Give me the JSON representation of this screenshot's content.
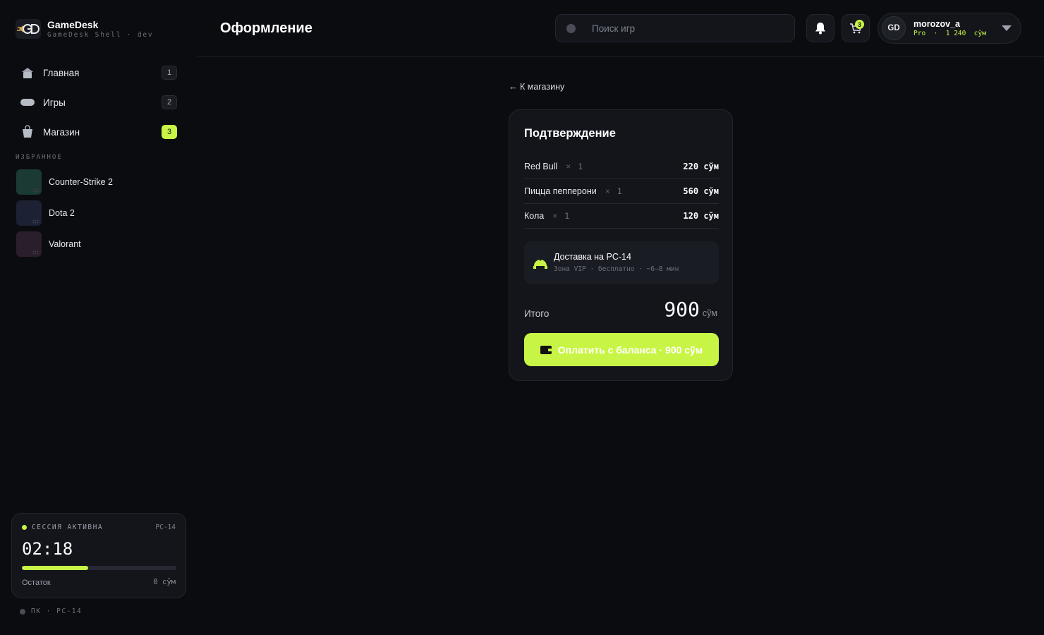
{
  "brand": {
    "name": "GameDesk",
    "subtitle": "GameDesk Shell · dev"
  },
  "nav": {
    "items": [
      {
        "label": "Главная",
        "badge": "1",
        "icon": "home-icon"
      },
      {
        "label": "Игры",
        "badge": "2",
        "icon": "gamepad-icon"
      },
      {
        "label": "Магазин",
        "badge": "3",
        "icon": "shopping-bag-icon",
        "active_badge": true
      }
    ]
  },
  "favorites": {
    "heading": "ИЗБРАННОЕ",
    "items": [
      {
        "label": "Counter-Strike 2",
        "color": "#1b3a34"
      },
      {
        "label": "Dota 2",
        "color": "#1c2233"
      },
      {
        "label": "Valorant",
        "color": "#2a1d2c"
      }
    ]
  },
  "session": {
    "status": "СЕССИЯ АКТИВНА",
    "pc": "PC-14",
    "time": "02:18",
    "progress": 0.43,
    "remaining_label": "Остаток",
    "remaining_amount": "0 сўм"
  },
  "footer": {
    "pc_label": "ПК · PC-14"
  },
  "header": {
    "title": "Оформление",
    "search_placeholder": "Поиск игр",
    "cart_count": "3",
    "user": {
      "initials": "GD",
      "name": "morozov_a",
      "meta": "Pro  ·  1 240  сўм"
    }
  },
  "checkout": {
    "back_label": "← К магазину",
    "title": "Подтверждение",
    "items": [
      {
        "name": "Red Bull",
        "x": "×",
        "qty": "1",
        "price": "220 сўм"
      },
      {
        "name": "Пицца пепперони",
        "x": "×",
        "qty": "1",
        "price": "560 сўм"
      },
      {
        "name": "Кола",
        "x": "×",
        "qty": "1",
        "price": "120 сўм"
      }
    ],
    "delivery": {
      "title": "Доставка на PC-14",
      "subtitle": "Зона VIP · бесплатно · ~6–8 мин"
    },
    "total_label": "Итого",
    "total_value": "900",
    "total_currency": "сўм",
    "pay_label": "Оплатить с баланса · 900 сўм"
  },
  "colors": {
    "accent": "#c8f545",
    "background": "#0b0c10",
    "card": "#13151b"
  }
}
